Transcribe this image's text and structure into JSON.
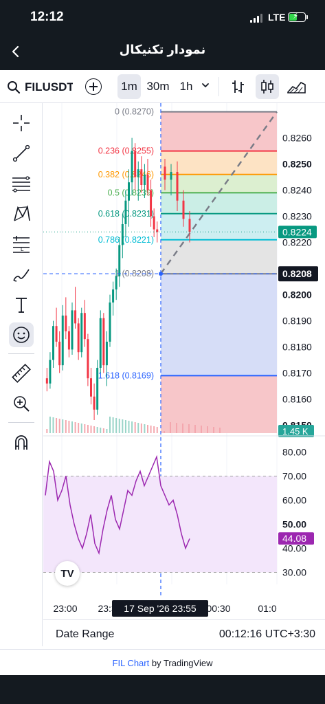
{
  "status_bar": {
    "time": "12:12",
    "network": "LTE"
  },
  "nav": {
    "title": "نمودار تکنیکال"
  },
  "toolbar": {
    "symbol": "FILUSDT",
    "intervals": [
      "1m",
      "30m",
      "1h"
    ],
    "active_interval": "1m"
  },
  "side_tools": [
    {
      "name": "crosshair-icon"
    },
    {
      "name": "trend-line-icon"
    },
    {
      "name": "horizontal-lines-icon"
    },
    {
      "name": "pattern-icon"
    },
    {
      "name": "fib-retracement-icon"
    },
    {
      "name": "brush-icon"
    },
    {
      "name": "text-icon"
    },
    {
      "name": "emoji-icon"
    },
    {
      "name": "ruler-icon"
    },
    {
      "name": "zoom-icon"
    },
    {
      "name": "magnet-icon"
    }
  ],
  "chart_data": {
    "type": "candlestick",
    "symbol": "FILUSDT",
    "interval": "1m",
    "price_axis": {
      "ticks": [
        "0.8260",
        "0.8250",
        "0.8240",
        "0.8230",
        "0.8220",
        "0.8200",
        "0.8190",
        "0.8180",
        "0.8170",
        "0.8160",
        "0.8150"
      ],
      "bold_ticks": [
        "0.8250",
        "0.8200",
        "0.8150"
      ],
      "range": [
        0.8147,
        0.8272
      ]
    },
    "last_price": {
      "value": "0.8224",
      "color": "#089981"
    },
    "crosshair_price": "0.8208",
    "volume_label": "1.45 K",
    "fib_levels": [
      {
        "ratio": "0",
        "price": "0.8270",
        "label": "0 (0.8270)",
        "color": "#787b86"
      },
      {
        "ratio": "0.236",
        "price": "0.8255",
        "label": "0.236 (0.8255)",
        "color": "#f23645"
      },
      {
        "ratio": "0.382",
        "price": "0.8246",
        "label": "0.382 (0.8246)",
        "color": "#ff9800"
      },
      {
        "ratio": "0.5",
        "price": "0.8239",
        "label": "0.5 (0.8239)",
        "color": "#4caf50"
      },
      {
        "ratio": "0.618",
        "price": "0.8231",
        "label": "0.618 (0.8231)",
        "color": "#089981"
      },
      {
        "ratio": "0.786",
        "price": "0.8221",
        "label": "0.786 (0.8221)",
        "color": "#00bcd4"
      },
      {
        "ratio": "1",
        "price": "0.8208",
        "label": "1 (0.8208)",
        "color": "#787b86"
      },
      {
        "ratio": "1.618",
        "price": "0.8169",
        "label": "1.618 (0.8169)",
        "color": "#2962ff"
      }
    ],
    "candles": [
      [
        0.8168,
        0.8172,
        0.8163,
        0.8166
      ],
      [
        0.8166,
        0.8178,
        0.8164,
        0.8175
      ],
      [
        0.8175,
        0.819,
        0.8172,
        0.8188
      ],
      [
        0.8188,
        0.8195,
        0.818,
        0.8182
      ],
      [
        0.8182,
        0.8186,
        0.817,
        0.8173
      ],
      [
        0.8173,
        0.8196,
        0.8171,
        0.8192
      ],
      [
        0.8192,
        0.8199,
        0.8183,
        0.8186
      ],
      [
        0.8186,
        0.8188,
        0.8176,
        0.8179
      ],
      [
        0.8179,
        0.8197,
        0.8177,
        0.8194
      ],
      [
        0.8194,
        0.8203,
        0.8187,
        0.8189
      ],
      [
        0.8189,
        0.8191,
        0.8175,
        0.8178
      ],
      [
        0.8178,
        0.8195,
        0.8176,
        0.8193
      ],
      [
        0.8193,
        0.8198,
        0.818,
        0.8183
      ],
      [
        0.8183,
        0.8185,
        0.8165,
        0.8168
      ],
      [
        0.8168,
        0.8172,
        0.8158,
        0.8161
      ],
      [
        0.8161,
        0.8166,
        0.8152,
        0.8156
      ],
      [
        0.8156,
        0.8175,
        0.8154,
        0.8172
      ],
      [
        0.8172,
        0.8194,
        0.817,
        0.8191
      ],
      [
        0.8191,
        0.8193,
        0.817,
        0.8173
      ],
      [
        0.8173,
        0.8186,
        0.8165,
        0.8182
      ],
      [
        0.8182,
        0.82,
        0.818,
        0.8197
      ],
      [
        0.8197,
        0.8205,
        0.8192,
        0.8202
      ],
      [
        0.8202,
        0.821,
        0.8198,
        0.8207
      ],
      [
        0.8207,
        0.8222,
        0.8203,
        0.8219
      ],
      [
        0.8219,
        0.8231,
        0.8214,
        0.8227
      ],
      [
        0.8227,
        0.824,
        0.8222,
        0.8236
      ],
      [
        0.8236,
        0.8248,
        0.8226,
        0.8243
      ],
      [
        0.8243,
        0.826,
        0.8238,
        0.8255
      ],
      [
        0.8255,
        0.8258,
        0.824,
        0.8245
      ],
      [
        0.8245,
        0.8251,
        0.8236,
        0.8248
      ],
      [
        0.8248,
        0.8253,
        0.8239,
        0.8242
      ],
      [
        0.8242,
        0.825,
        0.8237,
        0.8246
      ],
      [
        0.8246,
        0.8252,
        0.8238,
        0.824
      ],
      [
        0.824,
        0.8244,
        0.8226,
        0.823
      ],
      [
        0.823,
        0.8233,
        0.8222,
        0.8225
      ],
      [
        0.8225,
        0.8228,
        0.822,
        0.8224
      ]
    ],
    "rsi": {
      "current": "44.08",
      "ticks": [
        "80.00",
        "70.00",
        "60.00",
        "50.00",
        "40.00",
        "30.00"
      ],
      "bold_ticks": [
        "50.00"
      ],
      "band": [
        30,
        70
      ],
      "color": "#9c27b0",
      "values": [
        62,
        76,
        72,
        60,
        64,
        70,
        58,
        50,
        44,
        40,
        46,
        54,
        42,
        38,
        48,
        56,
        62,
        52,
        48,
        56,
        64,
        62,
        68,
        72,
        66,
        70,
        74,
        78,
        66,
        62,
        58,
        60,
        54,
        46,
        40,
        44
      ]
    },
    "time_axis": [
      "23:00",
      "23:30",
      "00:30",
      "01:0"
    ],
    "crosshair_time": "17 Sep '26   23:55"
  },
  "footer": {
    "date_range": "Date Range",
    "clock": "00:12:16 UTC+3:30"
  },
  "attribution": {
    "link_text": "FIL Chart",
    "suffix": " by TradingView"
  },
  "tv_logo": "TV"
}
